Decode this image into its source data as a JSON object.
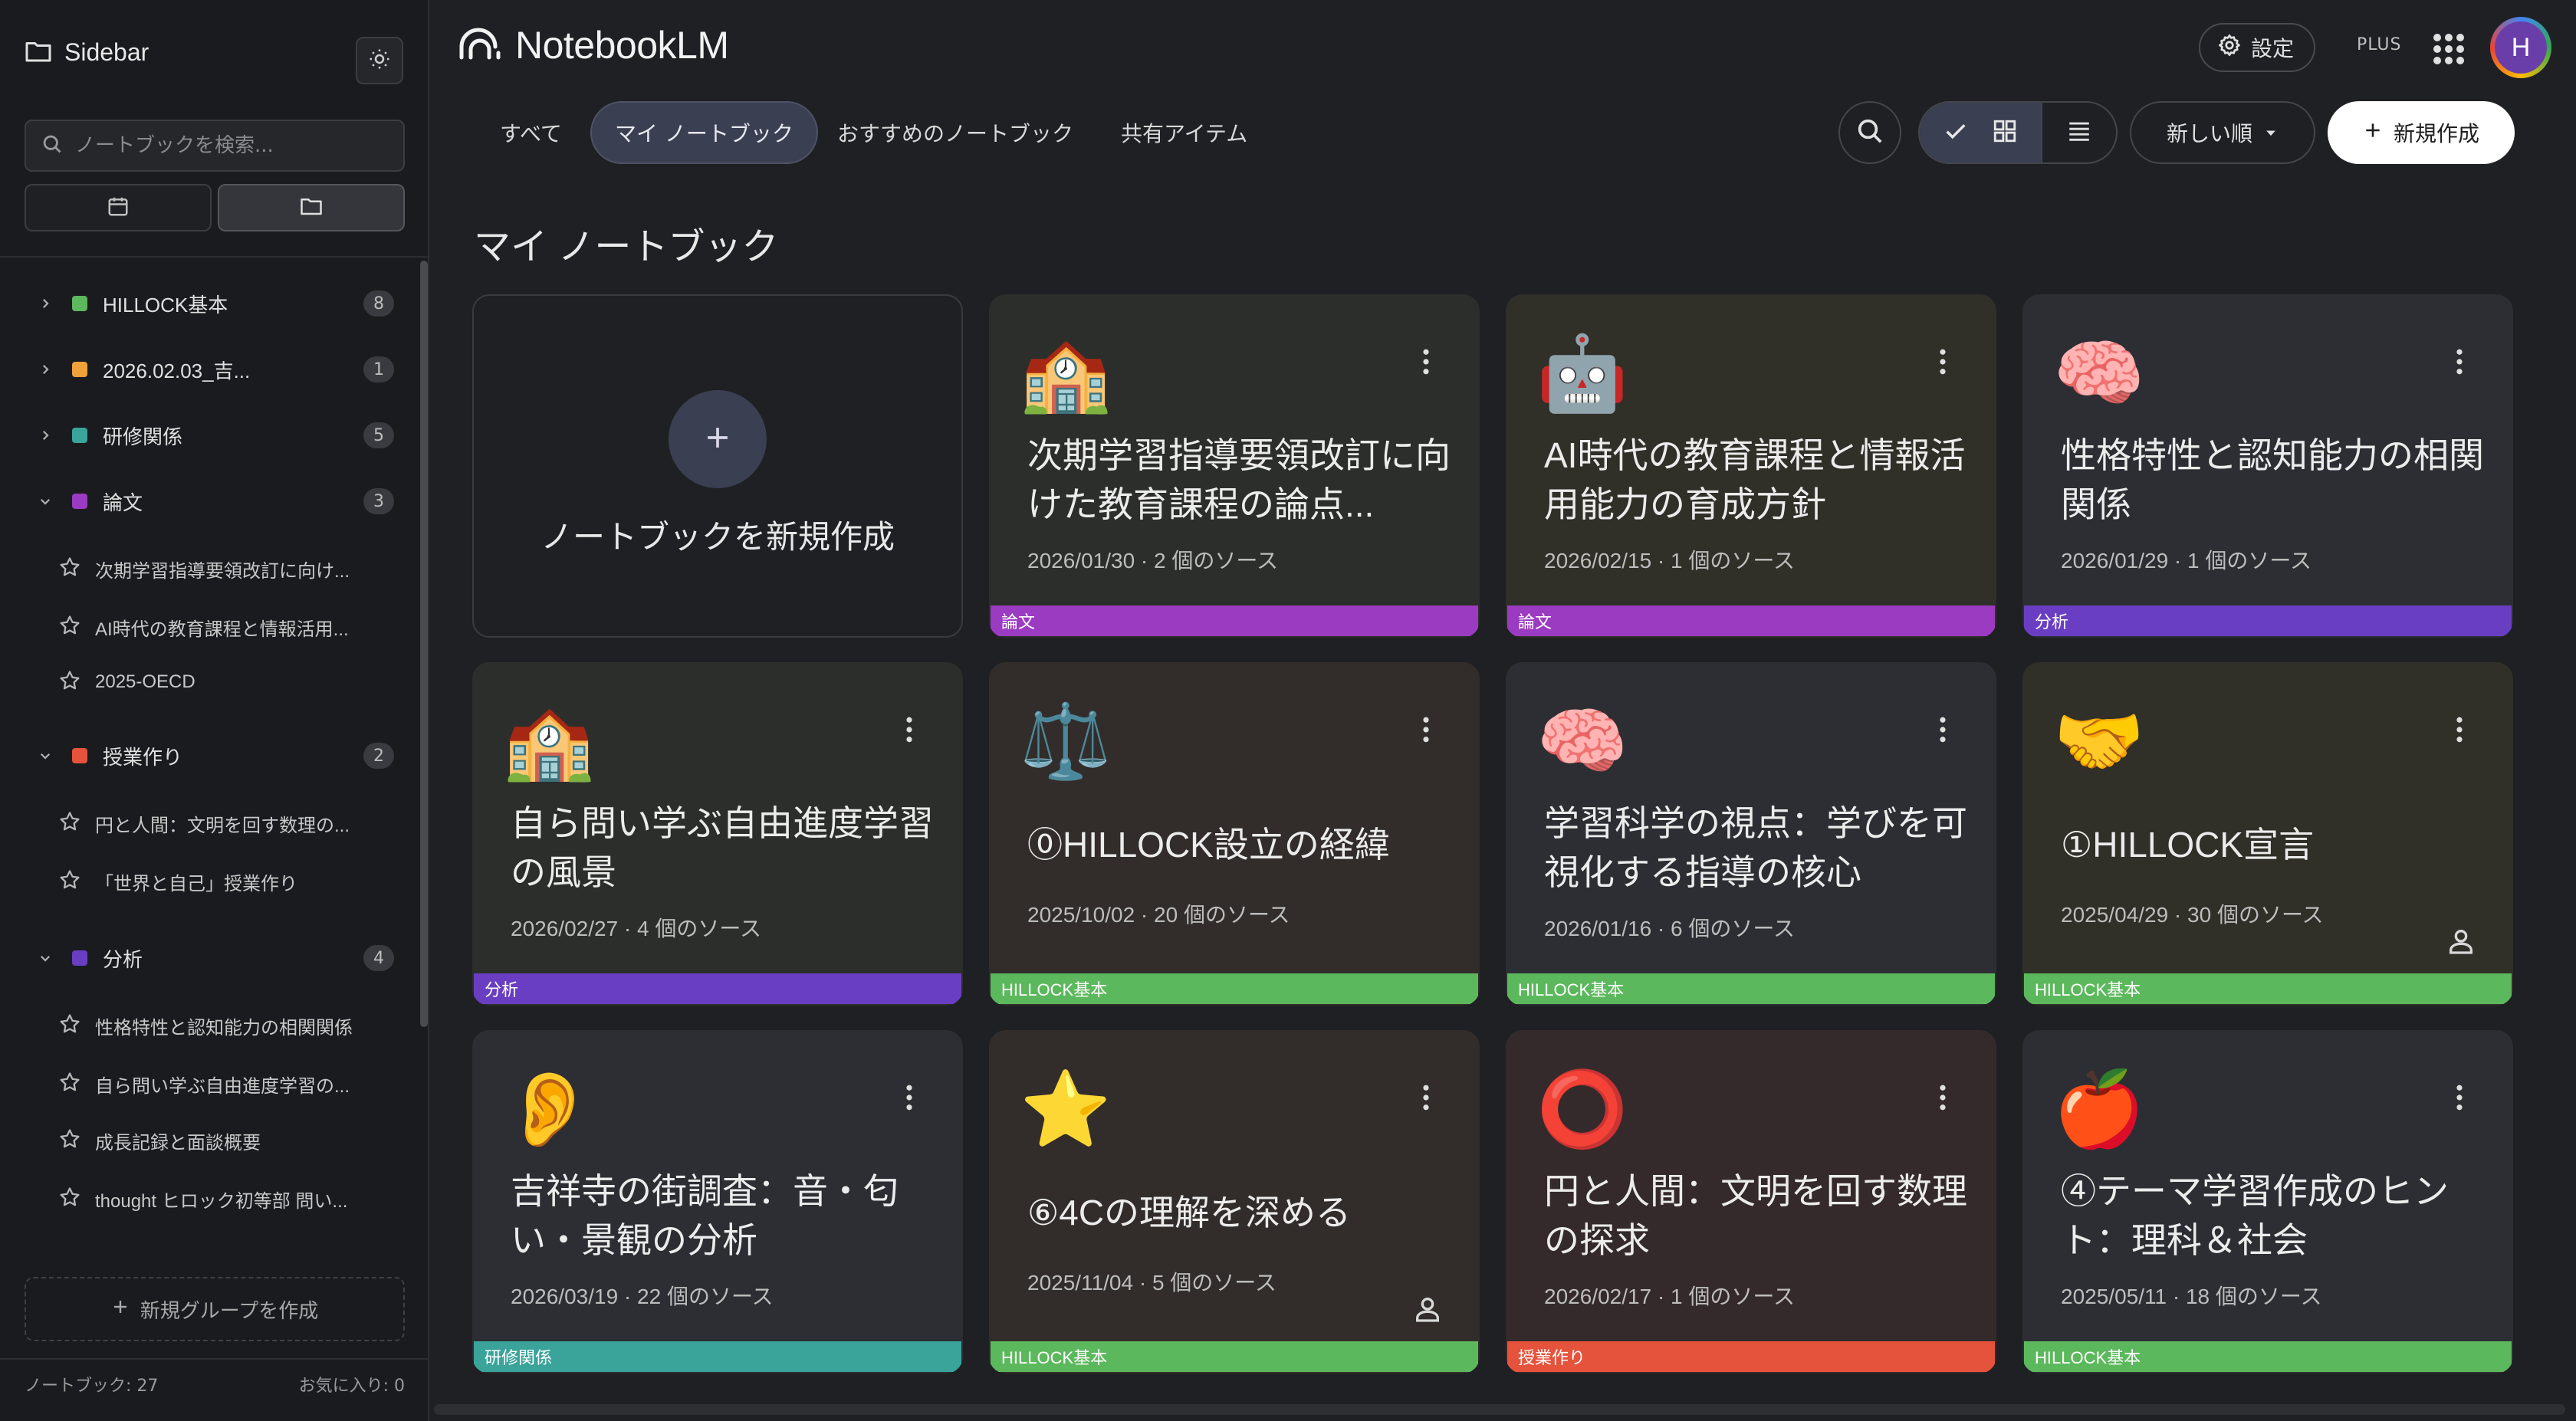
{
  "sidebar": {
    "title": "Sidebar",
    "search_placeholder": "ノートブックを検索...",
    "groups": [
      {
        "name": "HILLOCK基本",
        "count": "8",
        "color": "#5cb85c",
        "expanded": false
      },
      {
        "name": "2026.02.03_吉...",
        "count": "1",
        "color": "#f0a23a",
        "expanded": false
      },
      {
        "name": "研修関係",
        "count": "5",
        "color": "#3aa39a",
        "expanded": false
      },
      {
        "name": "論文",
        "count": "3",
        "color": "#9b3bc2",
        "expanded": true,
        "items": [
          "次期学習指導要領改訂に向け...",
          "AI時代の教育課程と情報活用...",
          "2025-OECD"
        ]
      },
      {
        "name": "授業作り",
        "count": "2",
        "color": "#e5533d",
        "expanded": true,
        "items": [
          "円と人間：文明を回す数理の...",
          "「世界と自己」授業作り"
        ]
      },
      {
        "name": "分析",
        "count": "4",
        "color": "#6a3ec2",
        "expanded": true,
        "items": [
          "性格特性と認知能力の相関関係",
          "自ら問い学ぶ自由進度学習の...",
          "成長記録と面談概要",
          "thought ヒロック初等部 問い..."
        ]
      }
    ],
    "new_group_label": "新規グループを作成",
    "footer_notebooks": "ノートブック: 27",
    "footer_favorites": "お気に入り: 0"
  },
  "header": {
    "app_name": "NotebookLM",
    "settings_label": "設定",
    "plan_label": "PLUS",
    "avatar_letter": "H"
  },
  "tabs": [
    {
      "label": "すべて",
      "active": false
    },
    {
      "label": "マイ ノートブック",
      "active": true
    },
    {
      "label": "おすすめのノートブック",
      "active": false
    },
    {
      "label": "共有アイテム",
      "active": false
    }
  ],
  "toolbar": {
    "sort_label": "新しい順",
    "create_label": "新規作成"
  },
  "section_title": "マイ ノートブック",
  "new_notebook_label": "ノートブックを新規作成",
  "cards": [
    {
      "emoji": "🏫",
      "title": "次期学習指導要領改訂に向けた教育課程の論点...",
      "meta": "2026/01/30 · 2 個のソース",
      "tag": "論文",
      "tag_color": "#9b3bc2",
      "bg": "#2c2e2b",
      "shared": false
    },
    {
      "emoji": "🤖",
      "title": "AI時代の教育課程と情報活用能力の育成方針",
      "meta": "2026/02/15 · 1 個のソース",
      "tag": "論文",
      "tag_color": "#9b3bc2",
      "bg": "#302f28",
      "shared": false
    },
    {
      "emoji": "🧠",
      "title": "性格特性と認知能力の相関関係",
      "meta": "2026/01/29 · 1 個のソース",
      "tag": "分析",
      "tag_color": "#6a3ec2",
      "bg": "#2d2e33",
      "shared": false
    },
    {
      "emoji": "🏫",
      "title": "自ら問い学ぶ自由進度学習の風景",
      "meta": "2026/02/27 · 4 個のソース",
      "tag": "分析",
      "tag_color": "#6a3ec2",
      "bg": "#2c2e2b",
      "shared": false
    },
    {
      "emoji": "⚖️",
      "title": "⓪HILLOCK設立の経緯",
      "meta": "2025/10/02 · 20 個のソース",
      "tag": "HILLOCK基本",
      "tag_color": "#5cb85c",
      "bg": "#322d2a",
      "shared": false
    },
    {
      "emoji": "🧠",
      "title": "学習科学の視点：学びを可視化する指導の核心",
      "meta": "2026/01/16 · 6 個のソース",
      "tag": "HILLOCK基本",
      "tag_color": "#5cb85c",
      "bg": "#2d2e33",
      "shared": false
    },
    {
      "emoji": "🤝",
      "title": "①HILLOCK宣言",
      "meta": "2025/04/29 · 30 個のソース",
      "tag": "HILLOCK基本",
      "tag_color": "#5cb85c",
      "bg": "#302f28",
      "shared": true
    },
    {
      "emoji": "👂",
      "title": "吉祥寺の街調査：音・匂い・景観の分析",
      "meta": "2026/03/19 · 22 個のソース",
      "tag": "研修関係",
      "tag_color": "#3aa39a",
      "bg": "#2d2e33",
      "shared": false
    },
    {
      "emoji": "⭐",
      "title": "⑥4Cの理解を深める",
      "meta": "2025/11/04 · 5 個のソース",
      "tag": "HILLOCK基本",
      "tag_color": "#5cb85c",
      "bg": "#322d2a",
      "shared": true
    },
    {
      "emoji": "⭕",
      "title": "円と人間：文明を回す数理の探求",
      "meta": "2026/02/17 · 1 個のソース",
      "tag": "授業作り",
      "tag_color": "#e5533d",
      "bg": "#352a2b",
      "shared": false
    },
    {
      "emoji": "🍎",
      "title": "④テーマ学習作成のヒント：理科＆社会",
      "meta": "2025/05/11 · 18 個のソース",
      "tag": "HILLOCK基本",
      "tag_color": "#5cb85c",
      "bg": "#2d2e33",
      "shared": false
    }
  ]
}
